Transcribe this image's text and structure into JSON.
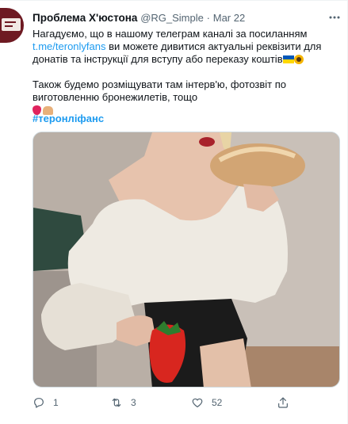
{
  "tweet": {
    "author_name": "Проблема Х'юстона",
    "author_handle": "@RG_Simple",
    "separator": "·",
    "date": "Mar 22",
    "text_line1_a": "Нагадуємо, що в нашому телеграм каналі за посиланням",
    "text_link": "t.me/teronlyfans",
    "text_line2_b": " ви можете дивитися актуальні реквізити для донатів та інструкції для вступу або переказу коштів",
    "text_para2": "Також будемо розміщувати там інтерв'ю, фотозвіт по виготовленню бронежилетів, тощо",
    "hashtag": "#теронліфанс",
    "emoji_flag_colors": [
      "#0057b7",
      "#ffd700"
    ],
    "image_description_icon": "photo-media"
  },
  "actions": {
    "reply_count": "1",
    "retweet_count": "3",
    "like_count": "52"
  },
  "colors": {
    "accent": "#1d9bf0",
    "muted": "#536471",
    "text": "#0f1419",
    "border": "#cfd9de"
  },
  "icons": {
    "reply": "reply-icon",
    "retweet": "retweet-icon",
    "like": "heart-icon",
    "share": "share-icon",
    "more": "more-icon"
  }
}
